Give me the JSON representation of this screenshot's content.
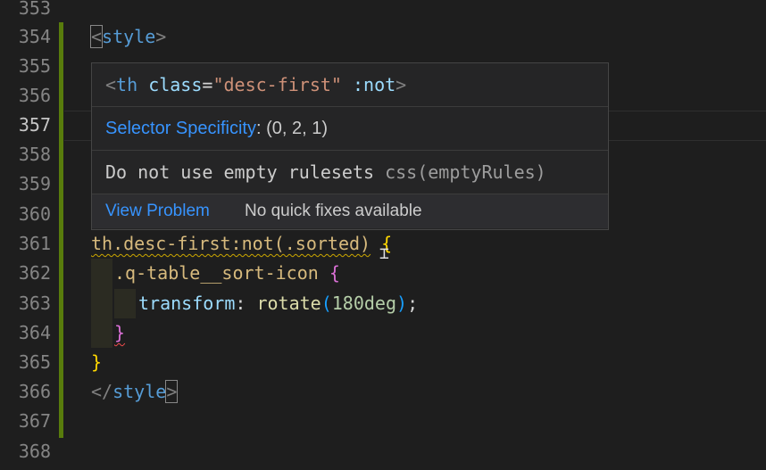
{
  "gutter": {
    "lines": [
      "353",
      "354",
      "355",
      "356",
      "357",
      "358",
      "359",
      "360",
      "361",
      "362",
      "363",
      "364",
      "365",
      "366",
      "367",
      "368"
    ],
    "active_line": "357"
  },
  "code": {
    "l354": {
      "open": "<",
      "tag": "style",
      "close": ">"
    },
    "l361": {
      "selector": "th.desc-first:not(.sorted)",
      "space": " ",
      "brace": "{"
    },
    "l362": {
      "selector": ".q-table__sort-icon",
      "space": " ",
      "brace": "{"
    },
    "l363": {
      "prop": "transform",
      "colon": ": ",
      "fn": "rotate",
      "paren_open": "(",
      "num": "180deg",
      "paren_close": ")",
      "semi": ";"
    },
    "l364": {
      "brace": "}"
    },
    "l365": {
      "brace": "}"
    },
    "l366": {
      "open": "</",
      "tag": "style",
      "close": ">"
    }
  },
  "hover": {
    "signature": {
      "lt": "<",
      "tag": "th",
      "sp": " ",
      "attr": "class",
      "eq": "=",
      "val": "\"desc-first\"",
      "rest": " :not",
      "gt": ">"
    },
    "specificity_label": "Selector Specificity",
    "specificity_value": ": (0, 2, 1)",
    "problem_message": "Do not use empty rulesets ",
    "problem_source": "css(emptyRules)",
    "view_problem": "View Problem",
    "no_quick_fixes": "No quick fixes available"
  },
  "colors": {
    "background": "#1e1e1e",
    "git_modified_bar": "#587c0c",
    "link": "#3794ff",
    "warning_squiggle": "#cca700",
    "error_squiggle": "#f14c4c"
  }
}
